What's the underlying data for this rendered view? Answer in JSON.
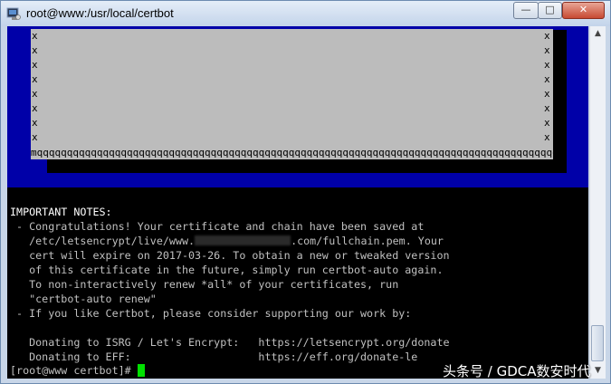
{
  "window": {
    "title": "root@www:/usr/local/certbot",
    "app_icon": "terminal-icon",
    "minimize_glyph": "—",
    "maximize_glyph": "□",
    "close_glyph": "✕"
  },
  "dialog": {
    "border_char_left": "x\nx\nx\nx\nx\nx\nx\nx",
    "border_char_right": "x\nx\nx\nx\nx\nx\nx\nx",
    "bottom_border": "mqqqqqqqqqqqqqqqqqqqqqqqqqqqqqqqqqqqqqqqqqqqqqqqqqqqqqqqqqqqqqqqqqqqqqqqqqqqqqqqqqqqqqqqqqqqqqqj"
  },
  "output": {
    "heading": "IMPORTANT NOTES:",
    "line1": " - Congratulations! Your certificate and chain have been saved at",
    "line2_pre": "   /etc/letsencrypt/live/www.",
    "line2_post": ".com/fullchain.pem. Your",
    "line3": "   cert will expire on 2017-03-26. To obtain a new or tweaked version",
    "line4": "   of this certificate in the future, simply run certbot-auto again.",
    "line5": "   To non-interactively renew *all* of your certificates, run",
    "line6": "   \"certbot-auto renew\"",
    "line7": " - If you like Certbot, please consider supporting our work by:",
    "line8": "",
    "line9": "   Donating to ISRG / Let's Encrypt:   https://letsencrypt.org/donate",
    "line10": "   Donating to EFF:                    https://eff.org/donate-le"
  },
  "prompt": {
    "text": "[root@www certbot]# "
  },
  "watermark": {
    "text": "头条号 / GDCA数安时代"
  },
  "colors": {
    "dialog_blue": "#0000a8",
    "dialog_gray": "#bcbcbc",
    "cursor_green": "#00e000"
  }
}
